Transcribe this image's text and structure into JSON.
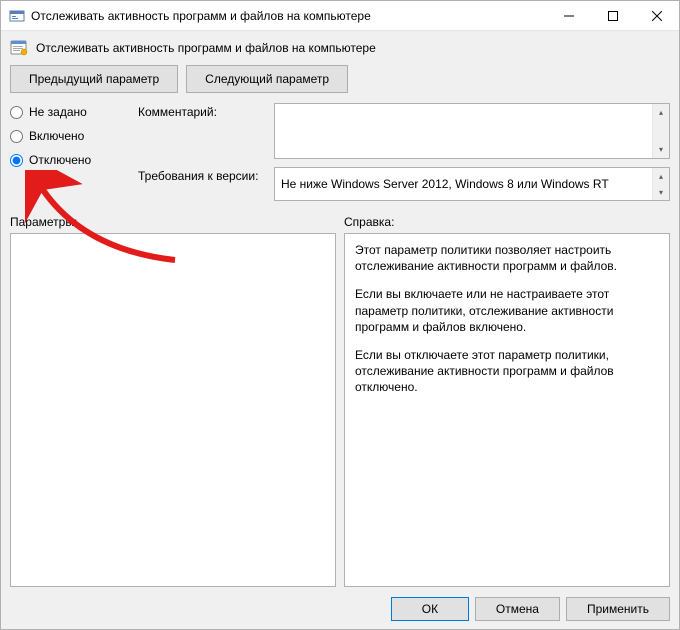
{
  "window": {
    "title": "Отслеживать активность программ и файлов на компьютере"
  },
  "header": {
    "title": "Отслеживать активность программ и файлов на компьютере"
  },
  "nav": {
    "prev": "Предыдущий параметр",
    "next": "Следующий параметр"
  },
  "radios": {
    "not_configured": "Не задано",
    "enabled": "Включено",
    "disabled": "Отключено",
    "selected": "disabled"
  },
  "fields": {
    "comment_label": "Комментарий:",
    "comment_value": "",
    "supported_label": "Требования к версии:",
    "supported_value": "Не ниже Windows Server 2012, Windows 8 или Windows RT"
  },
  "panes": {
    "params_label": "Параметры:",
    "help_label": "Справка:",
    "help_paragraphs": [
      "Этот параметр политики позволяет настроить отслеживание активности программ и файлов.",
      "Если вы включаете или не настраиваете этот параметр политики, отслеживание активности программ и файлов включено.",
      "Если вы отключаете этот параметр политики, отслеживание активности программ и файлов отключено."
    ]
  },
  "footer": {
    "ok": "ОК",
    "cancel": "Отмена",
    "apply": "Применить"
  }
}
